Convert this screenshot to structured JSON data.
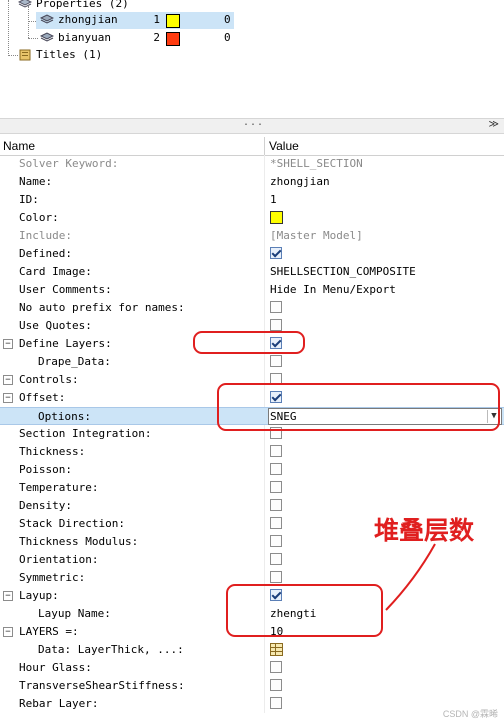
{
  "tree": {
    "properties_label": "Properties (2)",
    "items": [
      {
        "name": "zhongjian",
        "index": "1",
        "color": "#ffff00",
        "count": "0"
      },
      {
        "name": "bianyuan",
        "index": "2",
        "color": "#ff3b10",
        "count": "0"
      }
    ],
    "titles_label": "Titles (1)"
  },
  "splitter": {
    "dots": "...",
    "chevron": "≫"
  },
  "grid": {
    "header": {
      "name": "Name",
      "value": "Value"
    },
    "rows": [
      {
        "name": "Solver Keyword:",
        "value": "*SHELL_SECTION"
      },
      {
        "name": "Name:",
        "value": "zhongjian"
      },
      {
        "name": "ID:",
        "value": "1"
      },
      {
        "name": "Color:",
        "value_color": "#ffff00"
      },
      {
        "name": "Include:",
        "value": "[Master Model]"
      },
      {
        "name": "Defined:",
        "checked": true
      },
      {
        "name": "Card Image:",
        "value": "SHELLSECTION_COMPOSITE"
      },
      {
        "name": "User Comments:",
        "value": "Hide In Menu/Export"
      },
      {
        "name": "No auto prefix for names:",
        "checked": false
      },
      {
        "name": "Use Quotes:",
        "checked": false
      },
      {
        "name": "Define Layers:",
        "checked": true,
        "expander": "−"
      },
      {
        "name": "Drape_Data:",
        "checked": false
      },
      {
        "name": "Controls:",
        "checked": false,
        "expander": "−"
      },
      {
        "name": "Offset:",
        "checked": true,
        "expander": "−"
      },
      {
        "name": "Options:",
        "value": "SNEG"
      },
      {
        "name": "Section Integration:",
        "checked": false
      },
      {
        "name": "Thickness:",
        "checked": false
      },
      {
        "name": "Poisson:",
        "checked": false
      },
      {
        "name": "Temperature:",
        "checked": false
      },
      {
        "name": "Density:",
        "checked": false
      },
      {
        "name": "Stack Direction:",
        "checked": false
      },
      {
        "name": "Thickness Modulus:",
        "checked": false
      },
      {
        "name": "Orientation:",
        "checked": false
      },
      {
        "name": "Symmetric:",
        "checked": false
      },
      {
        "name": "Layup:",
        "checked": true,
        "expander": "−"
      },
      {
        "name": "Layup Name:",
        "value": "zhengti"
      },
      {
        "name": "LAYERS =:",
        "value": "10",
        "expander": "−"
      },
      {
        "name": "Data: LayerThick, ...:"
      },
      {
        "name": "Hour Glass:",
        "checked": false
      },
      {
        "name": "TransverseShearStiffness:",
        "checked": false
      },
      {
        "name": "Rebar Layer:",
        "checked": false
      }
    ]
  },
  "annotation": {
    "text": "堆叠层数",
    "color": "#e01f1f"
  },
  "watermark": "CSDN @霖晞"
}
